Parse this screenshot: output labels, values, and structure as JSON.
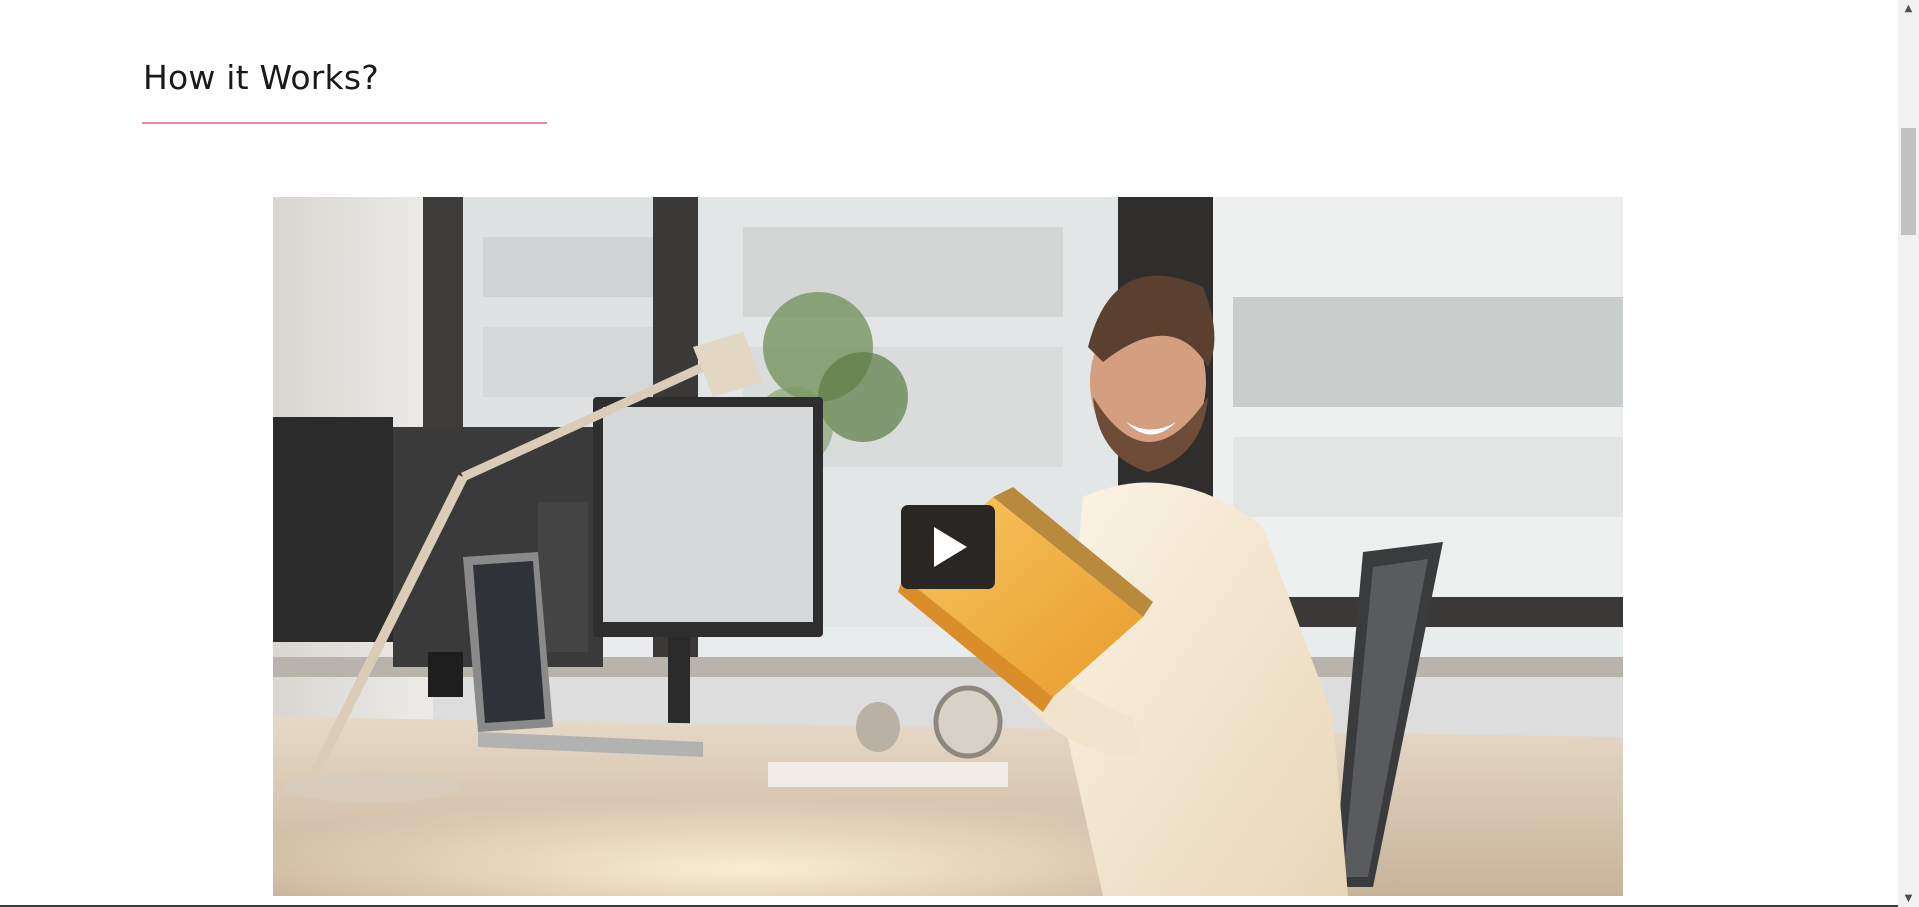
{
  "section": {
    "heading": "How it Works?",
    "accent_color": "#e58aa8"
  },
  "video": {
    "thumbnail_subject": "man-smiling-at-office-desk-with-book",
    "play_icon": "play-icon",
    "play_button_color": "#2a2623"
  },
  "scrollbar": {
    "up_arrow": "▲",
    "down_arrow": "▼"
  }
}
